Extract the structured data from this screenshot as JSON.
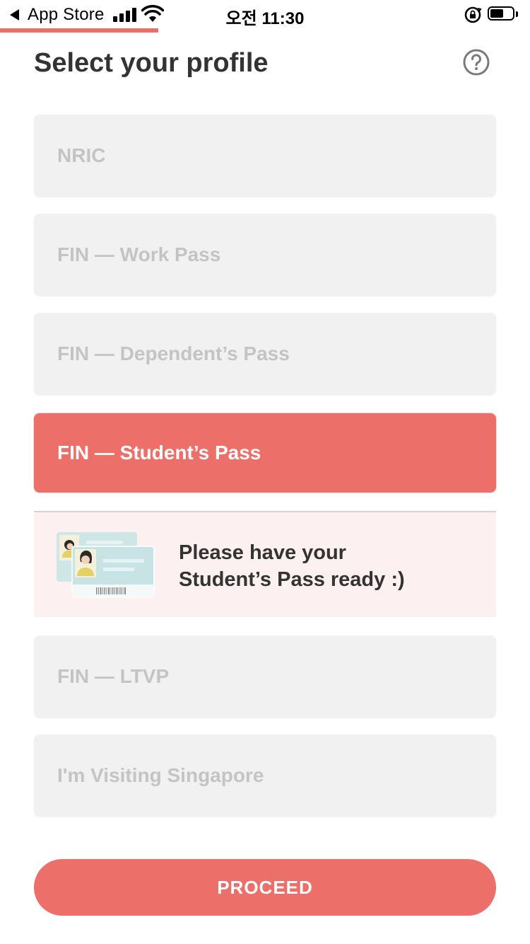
{
  "status_bar": {
    "back_label": "App Store",
    "time": "오전 11:30"
  },
  "header": {
    "title": "Select your profile",
    "help_icon": "help-circle-icon"
  },
  "options": [
    {
      "label": "NRIC",
      "selected": false
    },
    {
      "label": "FIN — Work Pass",
      "selected": false
    },
    {
      "label": "FIN — Dependent’s Pass",
      "selected": false
    },
    {
      "label": "FIN — Student’s Pass",
      "selected": true
    },
    {
      "label": "FIN — LTVP",
      "selected": false
    },
    {
      "label": "I'm Visiting Singapore",
      "selected": false
    }
  ],
  "info_panel": {
    "line1": "Please have your",
    "line2": "Student’s Pass ready :)",
    "illustration": "id-cards-illustration"
  },
  "proceed_label": "PROCEED",
  "colors": {
    "accent": "#ec6f69",
    "option_bg": "#f1f1f1",
    "option_text": "#c4c4c4",
    "info_bg": "#fcf1f0"
  }
}
